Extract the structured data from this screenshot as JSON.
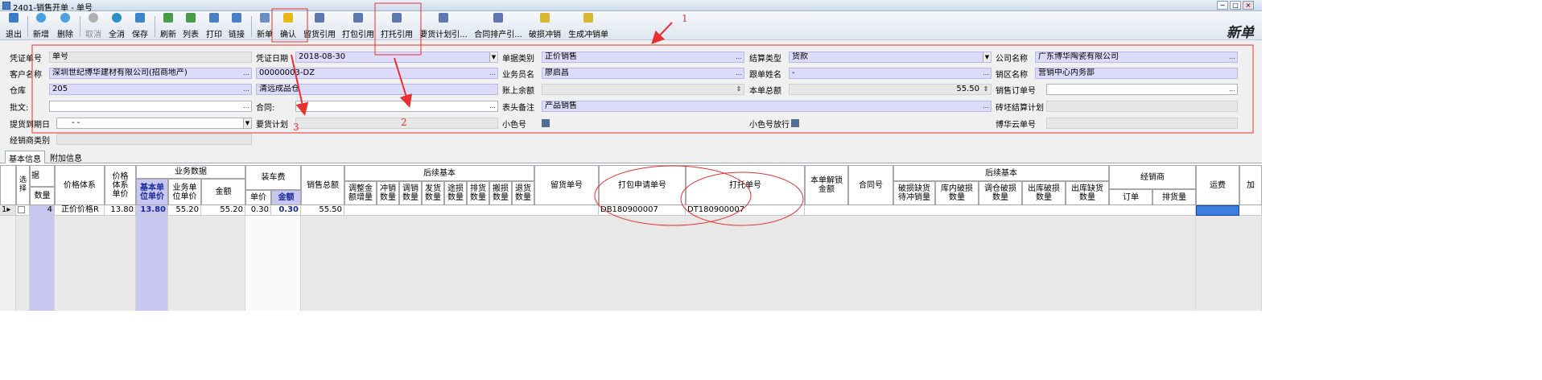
{
  "window": {
    "title": "2401-销售开单 - 单号",
    "controls": [
      "−",
      "□",
      "×"
    ]
  },
  "toolbar": {
    "mode_label": "新单",
    "buttons": [
      {
        "id": "exit",
        "label": "退出",
        "color": "#3c7bc8"
      },
      {
        "id": "add",
        "label": "新增",
        "color": "#4aa0e0"
      },
      {
        "id": "delete",
        "label": "删除",
        "color": "#4aa0e0"
      },
      {
        "id": "cancel",
        "label": "取消",
        "color": "#b0b0b0",
        "disabled": true
      },
      {
        "id": "undo_all",
        "label": "全消",
        "color": "#2a8fc8"
      },
      {
        "id": "save",
        "label": "保存",
        "color": "#3b84c9"
      },
      {
        "id": "refresh",
        "label": "刷新",
        "color": "#4a9b4a"
      },
      {
        "id": "list",
        "label": "列表",
        "color": "#4a9b4a"
      },
      {
        "id": "print",
        "label": "打印",
        "color": "#4a7fc1"
      },
      {
        "id": "link",
        "label": "链接",
        "color": "#4a7fc1"
      },
      {
        "id": "new_doc",
        "label": "新单",
        "color": "#6b8fc2"
      },
      {
        "id": "confirm",
        "label": "确认",
        "color": "#e8b818"
      },
      {
        "id": "reserve_ref",
        "label": "留货引用",
        "color": "#5f79b0"
      },
      {
        "id": "pack_ref",
        "label": "打包引用",
        "color": "#5f79b0"
      },
      {
        "id": "pallet_ref",
        "label": "打托引用",
        "color": "#5f79b0"
      },
      {
        "id": "plan_ref",
        "label": "要货计划引...",
        "color": "#5f79b0"
      },
      {
        "id": "contract_ref",
        "label": "合同排产引...",
        "color": "#5f79b0"
      },
      {
        "id": "damage_offset",
        "label": "破损冲销",
        "color": "#d8b830"
      },
      {
        "id": "gen_offset",
        "label": "生成冲销单",
        "color": "#d8b830"
      }
    ]
  },
  "form": {
    "fields": [
      {
        "key": "voucher_no",
        "label": "凭证单号",
        "value": "单号"
      },
      {
        "key": "voucher_date",
        "label": "凭证日期",
        "value": "2018-08-30"
      },
      {
        "key": "doc_type",
        "label": "单据类别",
        "value": "正价销售"
      },
      {
        "key": "settle_type",
        "label": "结算类型",
        "value": "货款"
      },
      {
        "key": "company",
        "label": "公司名称",
        "value": "广东博华陶瓷有限公司"
      },
      {
        "key": "customer",
        "label": "客户名称",
        "value": "深圳世纪博华建材有限公司(招商地产)"
      },
      {
        "key": "customer_code",
        "label": "",
        "value": "00000003-DZ"
      },
      {
        "key": "salesman",
        "label": "业务员名",
        "value": "廖启昌"
      },
      {
        "key": "follower",
        "label": "跟单姓名",
        "value": "-"
      },
      {
        "key": "sales_area",
        "label": "销区名称",
        "value": "营销中心内务部"
      },
      {
        "key": "warehouse",
        "label": "仓库",
        "value": "205"
      },
      {
        "key": "warehouse_name",
        "label": "",
        "value": "清远成品仓"
      },
      {
        "key": "balance",
        "label": "账上余额",
        "value": ""
      },
      {
        "key": "total",
        "label": "本单总额",
        "value": "55.50"
      },
      {
        "key": "sales_order",
        "label": "销售订单号",
        "value": ""
      },
      {
        "key": "approval",
        "label": "批文:",
        "value": ""
      },
      {
        "key": "contract",
        "label": "合同:",
        "value": ""
      },
      {
        "key": "header_note",
        "label": "表头备注",
        "value": "产品销售"
      },
      {
        "key": "brick_settle",
        "label": "砖坯结算计划",
        "value": ""
      },
      {
        "key": "delivery_due",
        "label": "提货到期日",
        "value": "-   -"
      },
      {
        "key": "demand_plan",
        "label": "要货计划",
        "value": ""
      },
      {
        "key": "small_color",
        "label": "小色号",
        "value": ""
      },
      {
        "key": "small_color_pass",
        "label": "小色号放行",
        "value": ""
      },
      {
        "key": "cloud_no",
        "label": "博华云单号",
        "value": ""
      },
      {
        "key": "dealer_type",
        "label": "经销商类别",
        "value": ""
      }
    ]
  },
  "tabs": [
    "基本信息",
    "附加信息"
  ],
  "grid": {
    "headers": {
      "select": "选择",
      "ju": "据",
      "qty": "数量",
      "price_sys": "价格体系",
      "price_sys_unit": "价格体系单价",
      "biz_data": "业务数据",
      "base_price": "基本单位单价",
      "biz_price": "业务单位单价",
      "amount": "金额",
      "loading_fee": "装车费",
      "unit_price": "单价",
      "fee_amount": "金额",
      "sales_total": "销售总额",
      "follow_basic": "后续基本",
      "adj_inc": "调整金额增量",
      "offset_qty": "冲销数量",
      "adj_qty": "调销数量",
      "ship_qty": "发货数量",
      "transit_dmg": "途损数量",
      "arrange_qty": "排货数量",
      "carry_dmg": "搬损数量",
      "return_qty": "退货数量",
      "reserve_no": "留货单号",
      "pack_req_no": "打包申请单号",
      "pallet_no": "打托单号",
      "unlock_amt": "本单解锁金额",
      "contract_no": "合同号",
      "follow_basic2": "后续基本",
      "dmg_pending": "破损缺货待冲销量",
      "inner_dmg": "库内破损数量",
      "transfer_dmg": "调仓破损数量",
      "out_dmg": "出库破损数量",
      "out_short": "出库缺货数量",
      "dealer": "经销商",
      "order_no": "订单",
      "arrange_amt": "排货量",
      "freight": "运费",
      "extra": "加"
    },
    "rows": [
      {
        "row_no": "1",
        "qty": "4",
        "price_sys": "正价价格R",
        "price_sys_unit": "13.80",
        "base_price": "13.80",
        "biz_price": "55.20",
        "amount": "55.20",
        "unit_price": "0.30",
        "fee_amount": "0.30",
        "sales_total": "55.50",
        "pack_req_no": "DB180900007",
        "pallet_no": "DT180900007"
      }
    ]
  },
  "annotations": [
    "1",
    "2",
    "3"
  ],
  "colors": {
    "annotation": "#e83030",
    "selected_cell": "#3d7ee0",
    "blue_field": "#dcdcfa",
    "blue_col": "#c7c7f2"
  }
}
